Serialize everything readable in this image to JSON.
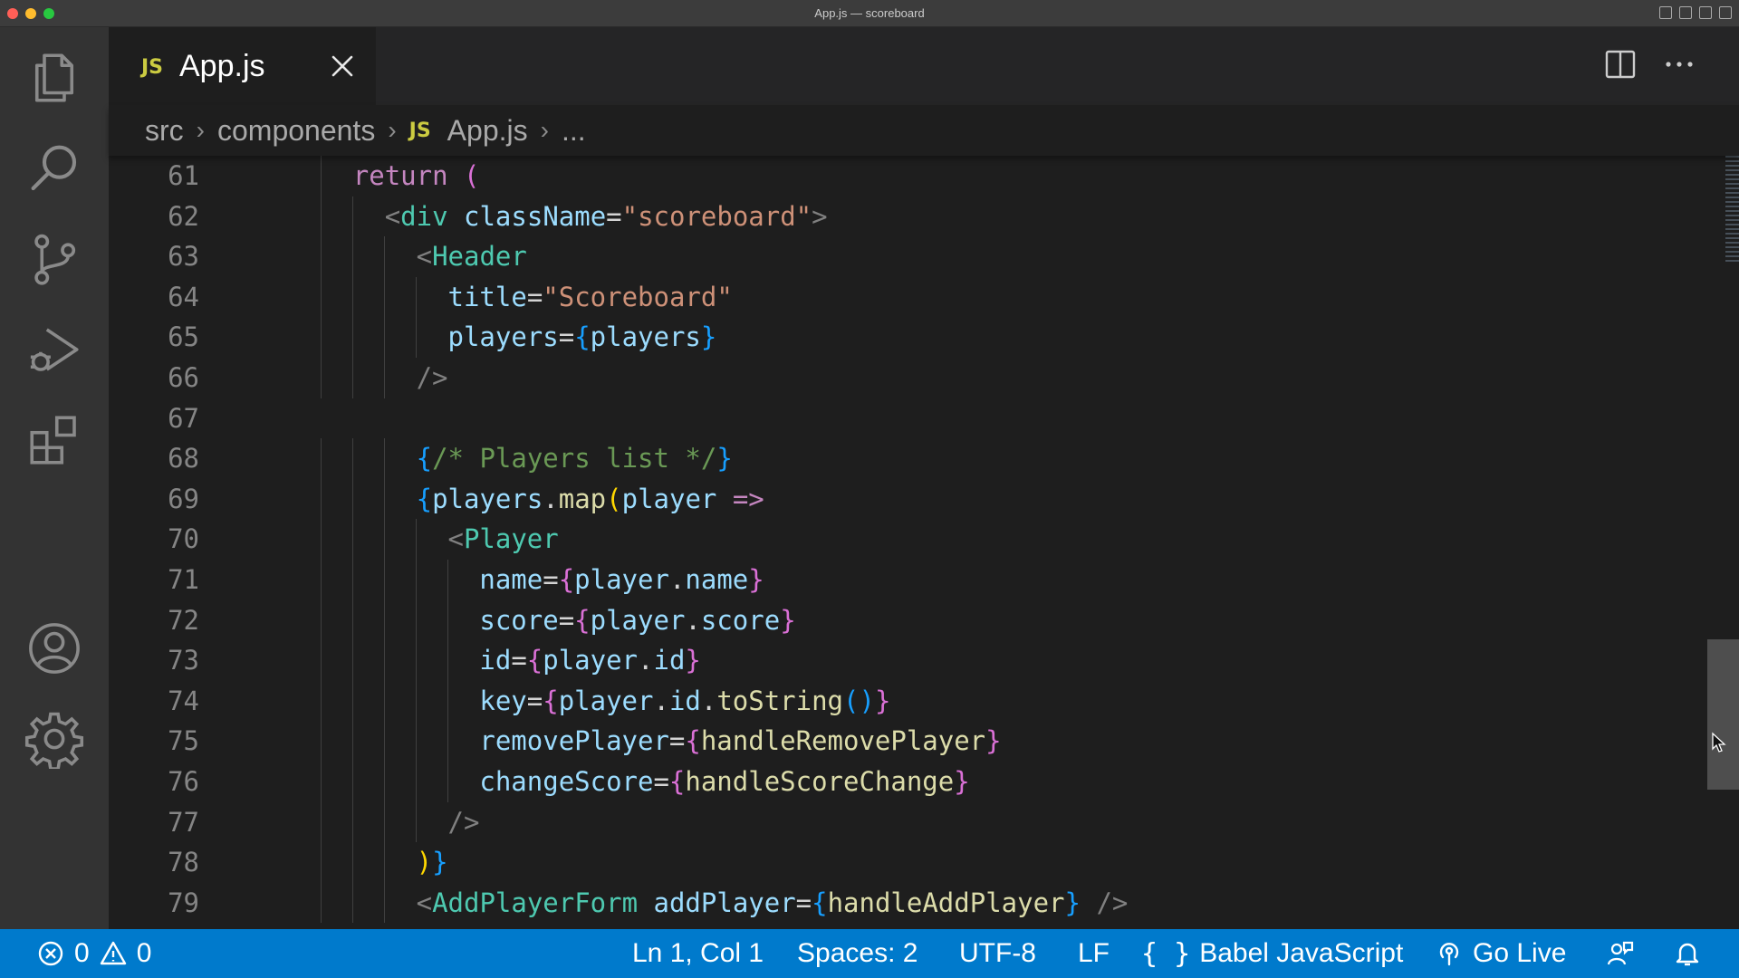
{
  "window": {
    "title": "App.js — scoreboard"
  },
  "activity_bar": {
    "items": [
      {
        "name": "explorer",
        "icon": "files-icon"
      },
      {
        "name": "search",
        "icon": "search-icon"
      },
      {
        "name": "source-control",
        "icon": "source-control-icon"
      },
      {
        "name": "run-and-debug",
        "icon": "run-debug-icon"
      },
      {
        "name": "extensions",
        "icon": "extensions-icon"
      },
      {
        "name": "accounts",
        "icon": "account-icon"
      },
      {
        "name": "manage",
        "icon": "gear-icon"
      }
    ]
  },
  "tab": {
    "lang_badge": "JS",
    "filename": "App.js"
  },
  "breadcrumb": {
    "segments": [
      "src",
      "components",
      "App.js",
      "..."
    ],
    "file_badge": "JS"
  },
  "editor": {
    "lines": [
      {
        "n": "61",
        "tokens": [
          [
            "kw",
            "return"
          ],
          [
            "op",
            " "
          ],
          [
            "b1",
            "("
          ]
        ]
      },
      {
        "n": "62",
        "tokens": [
          [
            "pun",
            "<"
          ],
          [
            "tag",
            "div"
          ],
          [
            "op",
            " "
          ],
          [
            "attr",
            "className"
          ],
          [
            "op",
            "="
          ],
          [
            "str",
            "\"scoreboard\""
          ],
          [
            "pun",
            ">"
          ]
        ]
      },
      {
        "n": "63",
        "tokens": [
          [
            "pun",
            "<"
          ],
          [
            "tag",
            "Header"
          ]
        ]
      },
      {
        "n": "64",
        "tokens": [
          [
            "attr",
            "title"
          ],
          [
            "op",
            "="
          ],
          [
            "str",
            "\"Scoreboard\""
          ]
        ]
      },
      {
        "n": "65",
        "tokens": [
          [
            "attr",
            "players"
          ],
          [
            "op",
            "="
          ],
          [
            "b2",
            "{"
          ],
          [
            "ident",
            "players"
          ],
          [
            "b2",
            "}"
          ]
        ]
      },
      {
        "n": "66",
        "tokens": [
          [
            "pun",
            "/>"
          ]
        ]
      },
      {
        "n": "67",
        "tokens": []
      },
      {
        "n": "68",
        "tokens": [
          [
            "b2",
            "{"
          ],
          [
            "cmt",
            "/* Players list */"
          ],
          [
            "b2",
            "}"
          ]
        ]
      },
      {
        "n": "69",
        "tokens": [
          [
            "b2",
            "{"
          ],
          [
            "ident",
            "players"
          ],
          [
            "op",
            "."
          ],
          [
            "fn",
            "map"
          ],
          [
            "b3",
            "("
          ],
          [
            "ident",
            "player"
          ],
          [
            "op",
            " "
          ],
          [
            "kw",
            "=>"
          ]
        ]
      },
      {
        "n": "70",
        "tokens": [
          [
            "pun",
            "<"
          ],
          [
            "tag",
            "Player"
          ]
        ]
      },
      {
        "n": "71",
        "tokens": [
          [
            "attr",
            "name"
          ],
          [
            "op",
            "="
          ],
          [
            "b1",
            "{"
          ],
          [
            "ident",
            "player"
          ],
          [
            "op",
            "."
          ],
          [
            "ident",
            "name"
          ],
          [
            "b1",
            "}"
          ]
        ]
      },
      {
        "n": "72",
        "tokens": [
          [
            "attr",
            "score"
          ],
          [
            "op",
            "="
          ],
          [
            "b1",
            "{"
          ],
          [
            "ident",
            "player"
          ],
          [
            "op",
            "."
          ],
          [
            "ident",
            "score"
          ],
          [
            "b1",
            "}"
          ]
        ]
      },
      {
        "n": "73",
        "tokens": [
          [
            "attr",
            "id"
          ],
          [
            "op",
            "="
          ],
          [
            "b1",
            "{"
          ],
          [
            "ident",
            "player"
          ],
          [
            "op",
            "."
          ],
          [
            "ident",
            "id"
          ],
          [
            "b1",
            "}"
          ]
        ]
      },
      {
        "n": "74",
        "tokens": [
          [
            "attr",
            "key"
          ],
          [
            "op",
            "="
          ],
          [
            "b1",
            "{"
          ],
          [
            "ident",
            "player"
          ],
          [
            "op",
            "."
          ],
          [
            "ident",
            "id"
          ],
          [
            "op",
            "."
          ],
          [
            "fn",
            "toString"
          ],
          [
            "b2",
            "()"
          ],
          [
            "b1",
            "}"
          ]
        ]
      },
      {
        "n": "75",
        "tokens": [
          [
            "attr",
            "removePlayer"
          ],
          [
            "op",
            "="
          ],
          [
            "b1",
            "{"
          ],
          [
            "fn",
            "handleRemovePlayer"
          ],
          [
            "b1",
            "}"
          ]
        ]
      },
      {
        "n": "76",
        "tokens": [
          [
            "attr",
            "changeScore"
          ],
          [
            "op",
            "="
          ],
          [
            "b1",
            "{"
          ],
          [
            "fn",
            "handleScoreChange"
          ],
          [
            "b1",
            "}"
          ]
        ]
      },
      {
        "n": "77",
        "tokens": [
          [
            "pun",
            "/>"
          ]
        ]
      },
      {
        "n": "78",
        "tokens": [
          [
            "b3",
            ")"
          ],
          [
            "b2",
            "}"
          ]
        ]
      },
      {
        "n": "79",
        "tokens": [
          [
            "pun",
            "<"
          ],
          [
            "tag",
            "AddPlayerForm"
          ],
          [
            "op",
            " "
          ],
          [
            "attr",
            "addPlayer"
          ],
          [
            "op",
            "="
          ],
          [
            "b2",
            "{"
          ],
          [
            "fn",
            "handleAddPlayer"
          ],
          [
            "b2",
            "}"
          ],
          [
            "op",
            " "
          ],
          [
            "pun",
            "/>"
          ]
        ]
      }
    ]
  },
  "status_bar": {
    "errors": "0",
    "warnings": "0",
    "cursor_position": "Ln 1, Col 1",
    "indentation": "Spaces: 2",
    "encoding": "UTF-8",
    "eol": "LF",
    "language": "Babel JavaScript",
    "go_live": "Go Live"
  }
}
